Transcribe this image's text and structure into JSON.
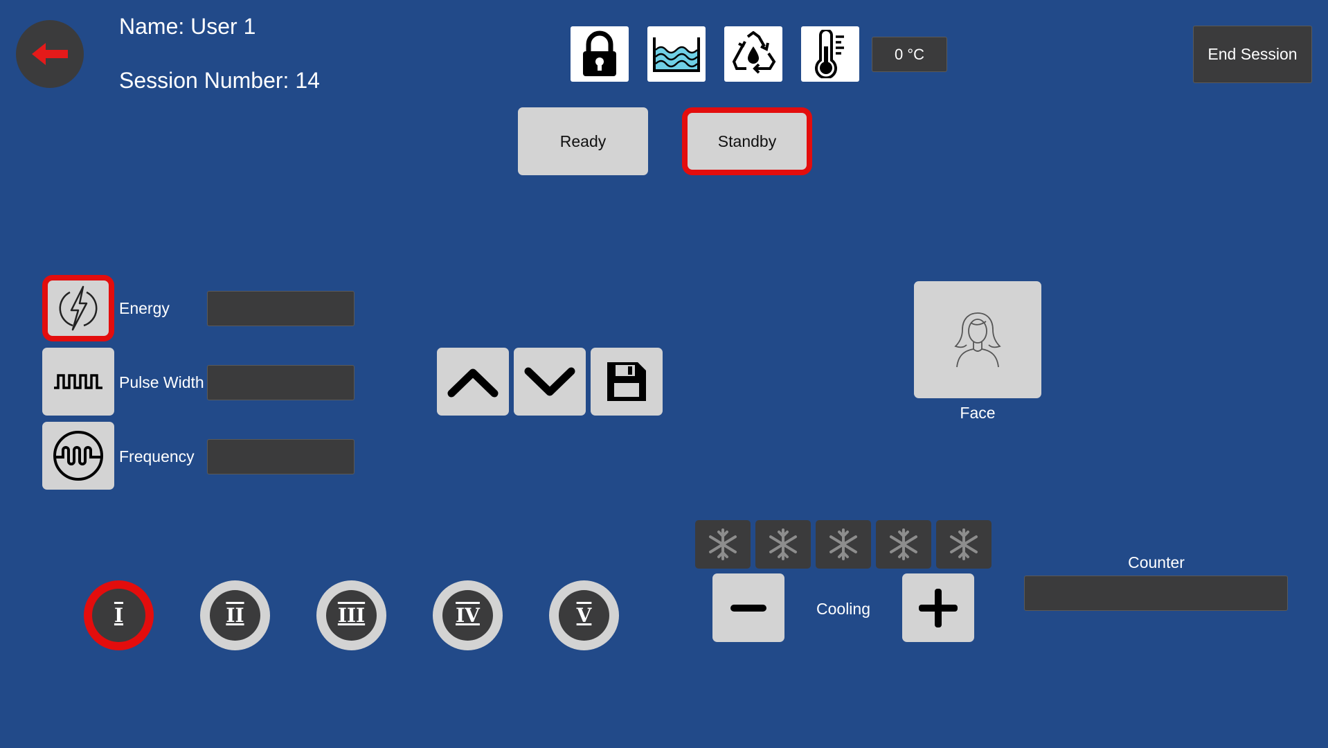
{
  "header": {
    "name_label": "Name: User 1",
    "session_label": "Session Number: 14",
    "temperature": "0 °C",
    "end_session": "End Session"
  },
  "status_icons": [
    "lock-icon",
    "water-level-icon",
    "recycle-water-icon",
    "thermometer-icon"
  ],
  "state": {
    "ready": "Ready",
    "standby": "Standby",
    "selected": "Standby"
  },
  "params": [
    {
      "label": "Energy",
      "icon": "lightning-icon",
      "value": "",
      "selected": true
    },
    {
      "label": "Pulse Width",
      "icon": "pulse-wave-icon",
      "value": "",
      "selected": false
    },
    {
      "label": "Frequency",
      "icon": "frequency-wave-icon",
      "value": "",
      "selected": false
    }
  ],
  "area": {
    "label": "Face"
  },
  "modes": {
    "items": [
      "I",
      "II",
      "III",
      "IV",
      "V"
    ],
    "selected": "I"
  },
  "cooling": {
    "label": "Cooling",
    "level": 0,
    "max": 5
  },
  "counter": {
    "label": "Counter",
    "value": ""
  },
  "colors": {
    "background": "#224a89",
    "dark_panel": "#3b3b3c",
    "button_light": "#d3d3d3",
    "selection": "#e30d0d"
  }
}
